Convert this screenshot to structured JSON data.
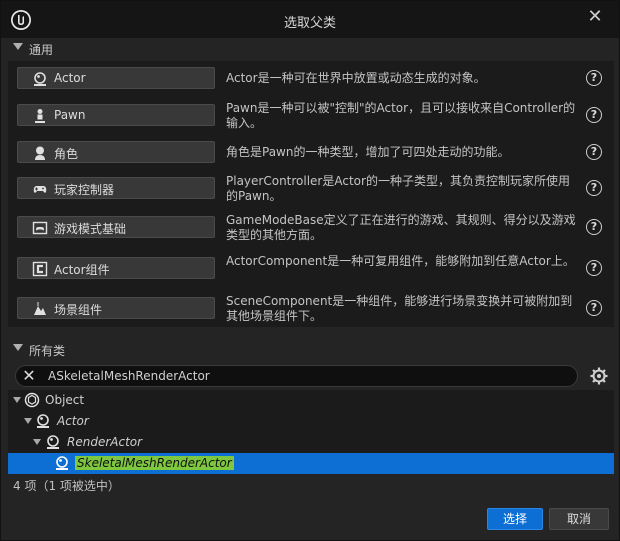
{
  "window": {
    "title": "选取父类",
    "close_glyph": "✕",
    "logo_icon": "unreal-engine-logo-icon"
  },
  "common_section": {
    "title": "通用",
    "classes": [
      {
        "label": "Actor",
        "icon": "actor-sphere-icon",
        "description": "Actor是一种可在世界中放置或动态生成的对象。"
      },
      {
        "label": "Pawn",
        "icon": "pawn-figure-icon",
        "description": "Pawn是一种可以被\"控制\"的Actor，且可以接收来自Controller的输入。"
      },
      {
        "label": "角色",
        "icon": "character-icon",
        "description": "角色是Pawn的一种类型，增加了可四处走动的功能。"
      },
      {
        "label": "玩家控制器",
        "icon": "gamepad-icon",
        "description": "PlayerController是Actor的一种子类型，其负责控制玩家所使用的Pawn。"
      },
      {
        "label": "游戏模式基础",
        "icon": "game-mode-icon",
        "description": "GameModeBase定义了正在进行的游戏、其规则、得分以及游戏类型的其他方面。"
      },
      {
        "label": "Actor组件",
        "icon": "actor-component-icon",
        "description": "ActorComponent是一种可复用组件，能够附加到任意Actor上。"
      },
      {
        "label": "场景组件",
        "icon": "scene-component-icon",
        "description": "SceneComponent是一种组件，能够进行场景变换并可被附加到其他场景组件下。"
      }
    ],
    "help_glyph": "?"
  },
  "all_classes_section": {
    "title": "所有类",
    "search": {
      "value": "ASkeletalMeshRenderActor",
      "clear_glyph": "✕"
    },
    "tree": [
      {
        "label": "Object",
        "depth": 0,
        "italic": false,
        "selected": false
      },
      {
        "label": "Actor",
        "depth": 1,
        "italic": true,
        "selected": false
      },
      {
        "label": "RenderActor",
        "depth": 2,
        "italic": true,
        "selected": false
      },
      {
        "label": "SkeletalMeshRenderActor",
        "depth": 3,
        "italic": true,
        "selected": true
      }
    ],
    "item_count": "4 项（1 项被选中）"
  },
  "footer": {
    "select_label": "选择",
    "cancel_label": "取消"
  },
  "colors": {
    "accent": "#0d6fd4",
    "highlight": "#7ec83f",
    "background": "#242424"
  }
}
